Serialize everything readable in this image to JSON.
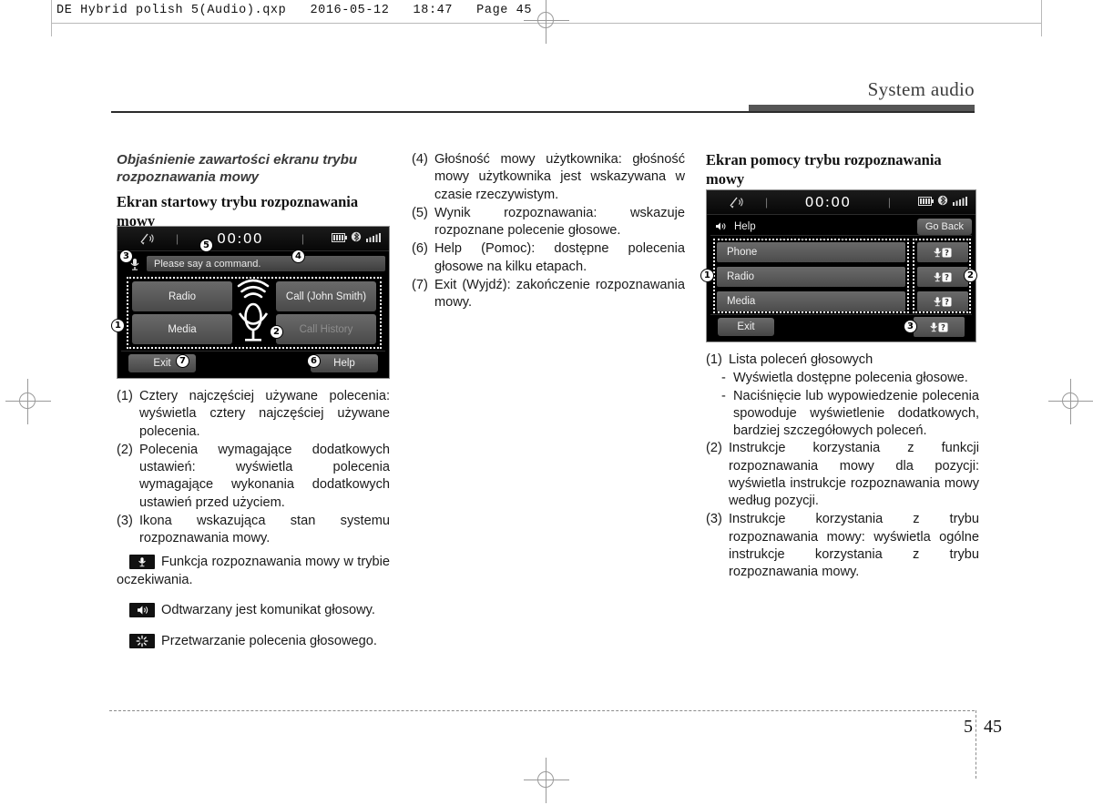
{
  "prepress": {
    "header_line": "DE Hybrid polish 5(Audio).qxp   2016-05-12   18:47   Page 45"
  },
  "running_head": "System audio",
  "folio": {
    "chapter": "5",
    "page": "45"
  },
  "col1": {
    "heading_italic": "Objaśnienie zawartości ekranu trybu rozpoznawania mowy",
    "heading_bold": "Ekran startowy trybu rozpoznawania mowy",
    "screenshot": {
      "name": "voice-recognition-start-screen",
      "status": {
        "clock": "00:00",
        "sep": "|"
      },
      "prompt": "Please say a command.",
      "tiles": [
        {
          "label": "Radio",
          "dim": false
        },
        {
          "label": "Call (John Smith)",
          "dim": false
        },
        {
          "label": "Media",
          "dim": false
        },
        {
          "label": "Call History",
          "dim": true
        }
      ],
      "exit_label": "Exit",
      "help_label": "Help",
      "callouts": [
        "1",
        "2",
        "3",
        "4",
        "5",
        "6",
        "7"
      ]
    },
    "items": [
      {
        "marker": "(1)",
        "text": "Cztery najczęściej używane polecenia: wyświetla cztery najczęściej używane polecenia."
      },
      {
        "marker": "(2)",
        "text": "Polecenia wymagające dodatkowych ustawień: wyświetla polecenia wymagające wykonania dodatkowych ustawień przed użyciem."
      },
      {
        "marker": "(3)",
        "text": "Ikona wskazująca stan systemu rozpoznawania mowy."
      }
    ],
    "icon_paras": [
      {
        "icon": "microphone-icon",
        "text": "Funkcja rozpoznawania mowy w trybie oczekiwania."
      },
      {
        "icon": "speaker-icon",
        "text": "Odtwarzany jest komunikat głosowy."
      },
      {
        "icon": "processing-spinner-icon",
        "text": "Przetwarzanie polecenia głosowego."
      }
    ]
  },
  "col2": {
    "items": [
      {
        "marker": "(4)",
        "text": "Głośność mowy użytkownika: głośność mowy użytkownika jest wskazywana w czasie rzeczywistym."
      },
      {
        "marker": "(5)",
        "text": "Wynik rozpoznawania: wskazuje rozpoznane polecenie głosowe."
      },
      {
        "marker": "(6)",
        "text": "Help (Pomoc): dostępne polecenia głosowe na kilku etapach."
      },
      {
        "marker": "(7)",
        "text": "Exit (Wyjdź): zakończenie rozpoznawania mowy."
      }
    ]
  },
  "col3": {
    "heading_bold": "Ekran pomocy trybu rozpoznawania mowy",
    "screenshot": {
      "name": "voice-recognition-help-screen",
      "status": {
        "clock": "00:00",
        "sep": "|"
      },
      "title": "Help",
      "go_back": "Go Back",
      "rows": [
        "Phone",
        "Radio",
        "Media"
      ],
      "exit_label": "Exit",
      "callouts": [
        "1",
        "2",
        "3"
      ]
    },
    "items": [
      {
        "marker": "(1)",
        "text": "Lista poleceń głosowych"
      },
      {
        "marker": "(2)",
        "text": "Instrukcje korzystania z funkcji rozpoznawania mowy dla pozycji: wyświetla instrukcje rozpoznawania mowy według pozycji."
      },
      {
        "marker": "(3)",
        "text": "Instrukcje korzystania z trybu rozpoznawania mowy: wyświetla ogólne instrukcje korzystania z trybu rozpoznawania mowy."
      }
    ],
    "subitems": [
      {
        "marker": "-",
        "text": "Wyświetla dostępne polecenia głosowe."
      },
      {
        "marker": "-",
        "text": "Naciśnięcie lub wypowiedzenie polecenia spowoduje wyświetlenie dodatkowych, bardziej szczegółowych poleceń."
      }
    ]
  },
  "colors": {
    "rule_dark": "#2b2b2b",
    "rule_thick": "#565656",
    "head_text": "#3d3d3d",
    "screen_bg": "#000000",
    "tile_top": "#6a6a6a",
    "tile_bottom": "#4a4a4a"
  }
}
